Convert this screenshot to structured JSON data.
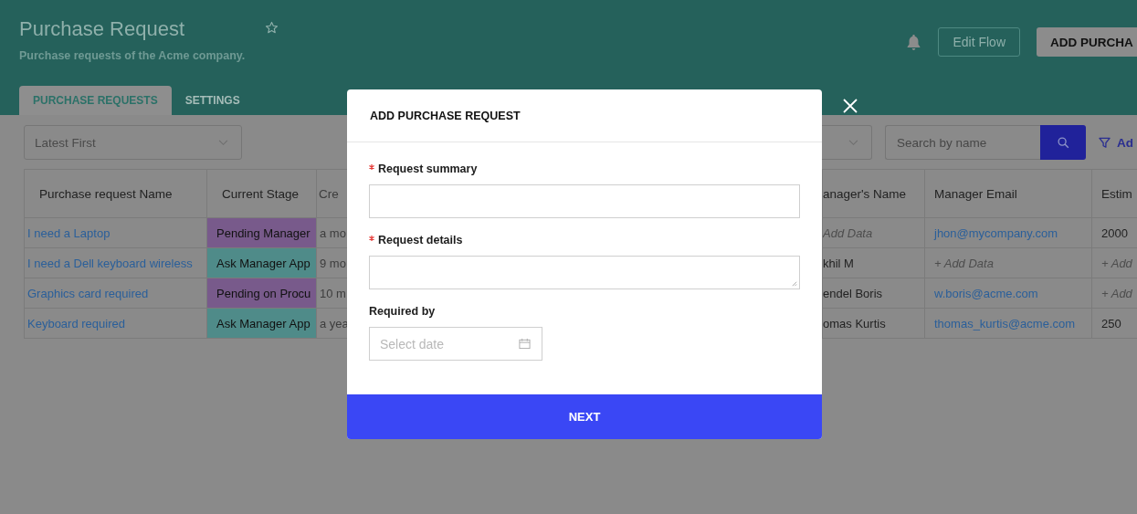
{
  "page": {
    "title": "Purchase Request",
    "subtitle": "Purchase requests of the Acme company."
  },
  "header_actions": {
    "edit_button": "Edit Flow",
    "add_button": "ADD PURCHA"
  },
  "tabs": [
    {
      "label": "PURCHASE REQUESTS",
      "selected": true
    },
    {
      "label": "SETTINGS",
      "selected": false
    }
  ],
  "toolbar": {
    "sort": "Latest First",
    "search_placeholder": "Search by name",
    "filter_link": "Ad"
  },
  "table": {
    "columns": [
      "Purchase request Name",
      "Current Stage",
      "Cre",
      "anager's Name",
      "Manager Email",
      "Estim"
    ],
    "rows": [
      [
        {
          "kind": "link",
          "text": "I need a Laptop"
        },
        {
          "kind": "stage",
          "text": "Pending Manager",
          "color": "#785a8b"
        },
        {
          "kind": "text",
          "text": "a mo"
        },
        {
          "kind": "placeholder",
          "text": "Add Data"
        },
        {
          "kind": "link",
          "text": "jhon@mycompany.com"
        },
        {
          "kind": "text",
          "text": "2000"
        }
      ],
      [
        {
          "kind": "link",
          "text": "I need a Dell keyboard wireless"
        },
        {
          "kind": "stage",
          "text": "Ask Manager App",
          "color": "#4f8b89"
        },
        {
          "kind": "text",
          "text": "9 mo"
        },
        {
          "kind": "text",
          "text": "khil M"
        },
        {
          "kind": "placeholder",
          "text": "+ Add Data"
        },
        {
          "kind": "placeholder",
          "text": "+ Add"
        }
      ],
      [
        {
          "kind": "link",
          "text": "Graphics card required"
        },
        {
          "kind": "stage",
          "text": "Pending on Procu",
          "color": "#785a8b"
        },
        {
          "kind": "text",
          "text": "10 m"
        },
        {
          "kind": "text",
          "text": "endel Boris"
        },
        {
          "kind": "link",
          "text": "w.boris@acme.com"
        },
        {
          "kind": "placeholder",
          "text": "+ Add"
        }
      ],
      [
        {
          "kind": "link",
          "text": "Keyboard required"
        },
        {
          "kind": "stage",
          "text": "Ask Manager App",
          "color": "#4f8b89"
        },
        {
          "kind": "text",
          "text": "a yea"
        },
        {
          "kind": "text",
          "text": "omas Kurtis"
        },
        {
          "kind": "link",
          "text": "thomas_kurtis@acme.com"
        },
        {
          "kind": "text",
          "text": "250"
        }
      ]
    ]
  },
  "modal": {
    "title": "ADD PURCHASE REQUEST",
    "fields": [
      {
        "label": "Request summary",
        "required": true,
        "kind": "text"
      },
      {
        "label": "Request details",
        "required": true,
        "kind": "textarea"
      },
      {
        "label": "Required by",
        "required": false,
        "kind": "date",
        "placeholder": "Select date"
      }
    ],
    "submit": "NEXT"
  }
}
